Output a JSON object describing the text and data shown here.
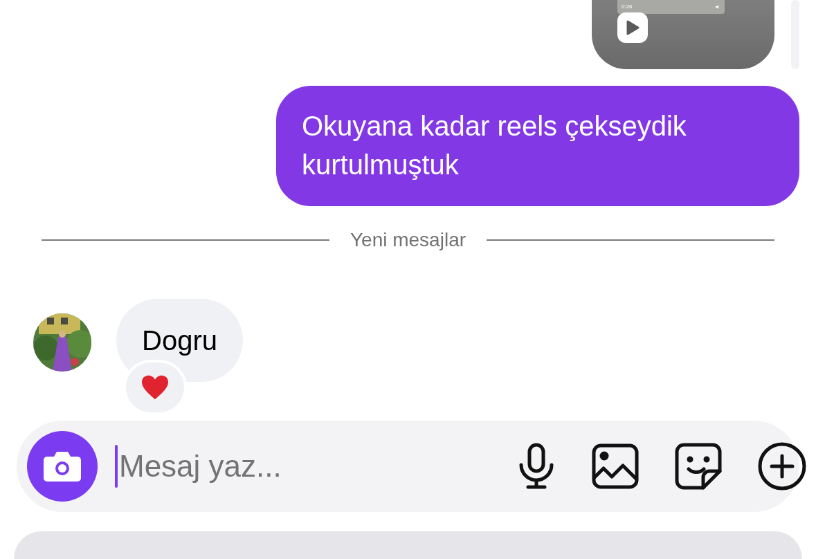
{
  "shared_reel": {
    "kind": "picture",
    "duration": "0:26"
  },
  "messages": [
    {
      "kind": "sent",
      "text": "Okuyana kadar reels çekseydik kurtulmuştuk"
    },
    {
      "kind": "divider",
      "text": "Yeni mesajlar"
    },
    {
      "kind": "received",
      "text": "Dogru",
      "reaction": true
    }
  ],
  "composer": {
    "placeholder": "Mesaj yaz..."
  }
}
